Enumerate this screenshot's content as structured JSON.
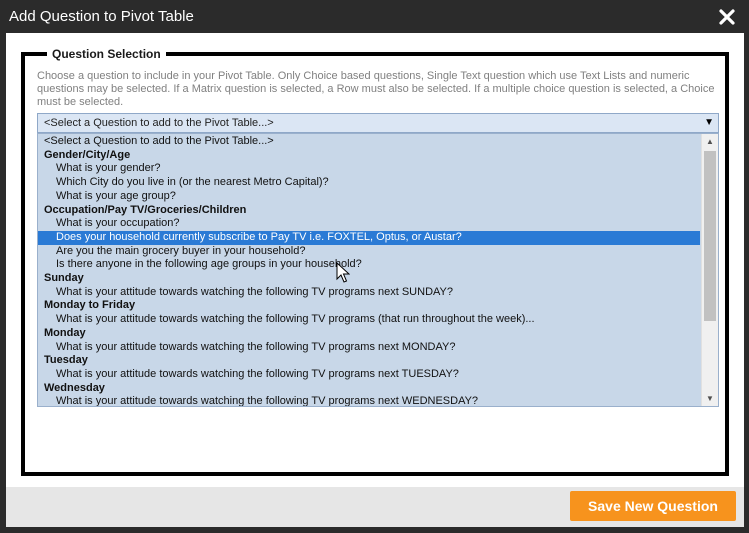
{
  "dialog": {
    "title": "Add Question to Pivot Table"
  },
  "section": {
    "legend": "Question Selection",
    "description": "Choose a question to include in your Pivot Table. Only Choice based questions, Single Text question which use Text Lists and numeric questions may be selected. If a Matrix question is selected, a Row must also be selected. If a multiple choice question is selected, a Choice must be selected."
  },
  "select": {
    "value": "<Select a Question to add to the Pivot Table...>"
  },
  "options": [
    {
      "kind": "placeholder",
      "label": "<Select a Question to add to the Pivot Table...>"
    },
    {
      "kind": "group",
      "label": "Gender/City/Age"
    },
    {
      "kind": "child",
      "label": "What is your gender?"
    },
    {
      "kind": "child",
      "label": "Which City do you live in (or the nearest Metro Capital)?"
    },
    {
      "kind": "child",
      "label": "What is your age group?"
    },
    {
      "kind": "group",
      "label": "Occupation/Pay TV/Groceries/Children"
    },
    {
      "kind": "child",
      "label": "What is your occupation?"
    },
    {
      "kind": "child",
      "label": "Does your household currently subscribe to Pay TV i.e. FOXTEL, Optus, or Austar?",
      "selected": true
    },
    {
      "kind": "child",
      "label": "Are you the main grocery buyer in your household?"
    },
    {
      "kind": "child",
      "label": "Is there anyone in the following age groups in your household?"
    },
    {
      "kind": "group",
      "label": "Sunday"
    },
    {
      "kind": "child",
      "label": "What is your attitude towards watching the following TV programs next SUNDAY?"
    },
    {
      "kind": "group",
      "label": "Monday to Friday"
    },
    {
      "kind": "child",
      "label": "What is your attitude towards watching the following TV programs (that run throughout the week)..."
    },
    {
      "kind": "group",
      "label": "Monday"
    },
    {
      "kind": "child",
      "label": "What is your attitude towards watching the following TV programs next MONDAY?"
    },
    {
      "kind": "group",
      "label": "Tuesday"
    },
    {
      "kind": "child",
      "label": "What is your attitude towards watching the following TV programs next TUESDAY?"
    },
    {
      "kind": "group",
      "label": "Wednesday"
    },
    {
      "kind": "child",
      "label": "What is your attitude towards watching the following TV programs next WEDNESDAY?"
    }
  ],
  "footer": {
    "save_label": "Save New Question"
  },
  "colors": {
    "accent": "#f7931d",
    "selection": "#2a7ad5",
    "listbox_bg": "#c8d7e8"
  },
  "icons": {
    "close": "close-icon",
    "dropdown": "chevron-down-icon",
    "cursor": "mouse-pointer-icon"
  }
}
